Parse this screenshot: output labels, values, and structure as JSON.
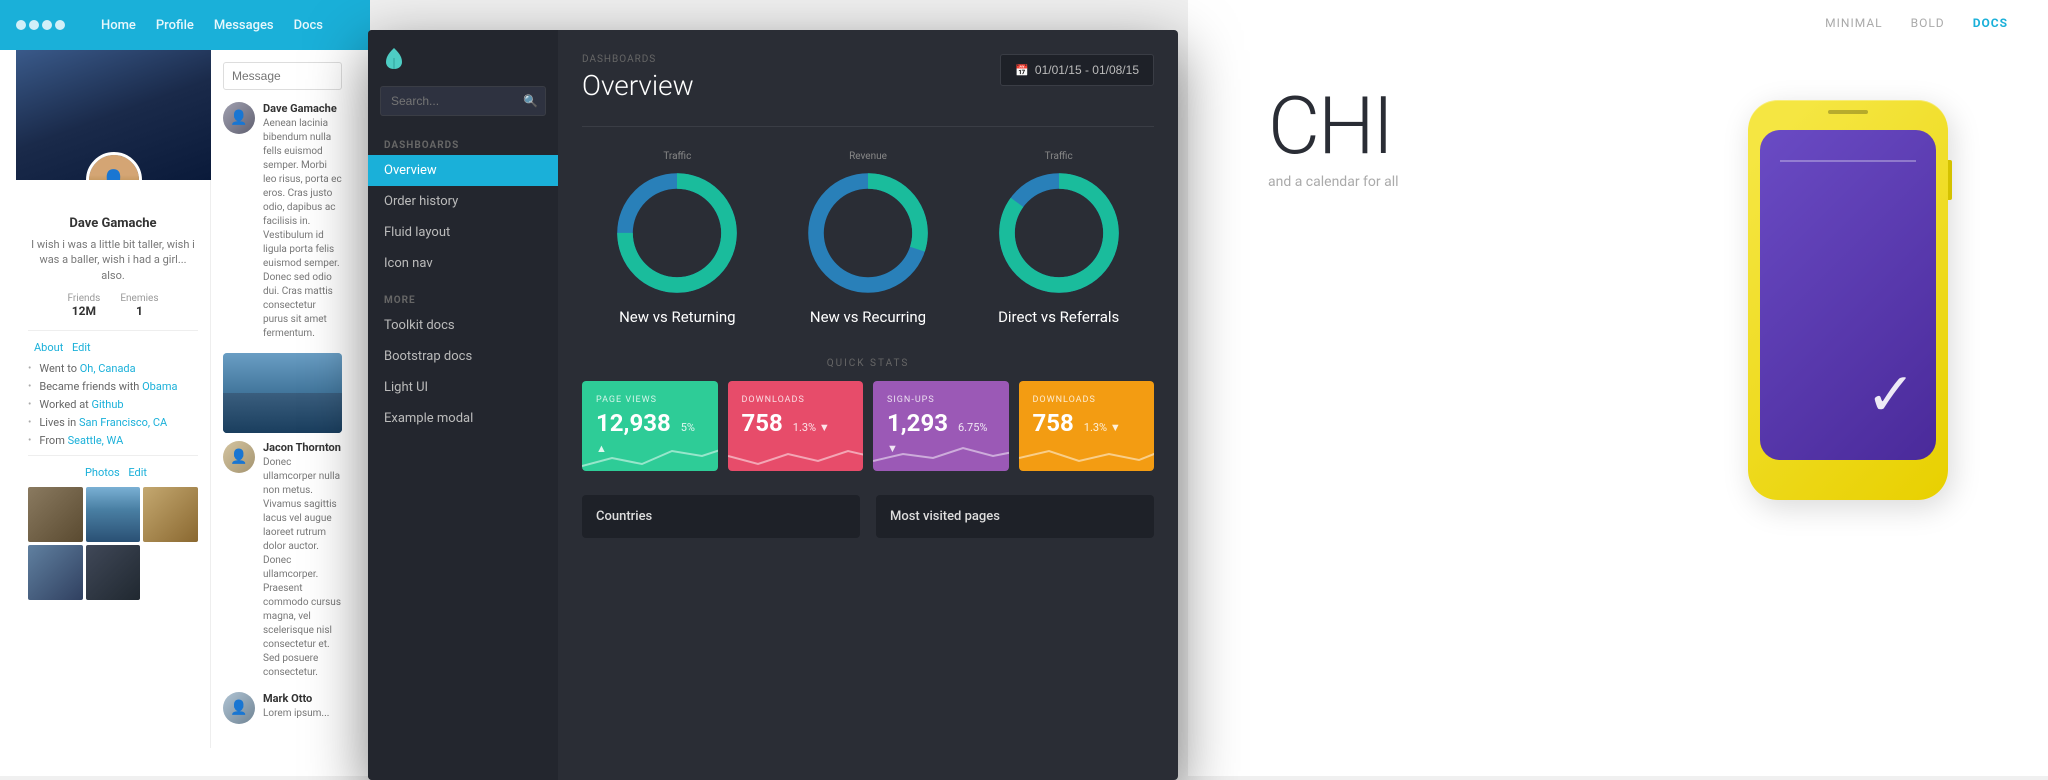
{
  "left_panel": {
    "nav": {
      "logo_dots": 4,
      "links": [
        "Home",
        "Profile",
        "Messages",
        "Docs"
      ],
      "active": "Profile"
    },
    "profile": {
      "name": "Dave Gamache",
      "bio": "I wish i was a little bit taller, wish i was a baller, wish i had a girl... also.",
      "stats": [
        {
          "label": "Friends",
          "value": "12M"
        },
        {
          "label": "Enemies",
          "value": "1"
        }
      ],
      "about_title": "About",
      "about_edit": "Edit",
      "about_items": [
        {
          "icon": "📍",
          "text": "Went to ",
          "link": "Oh, Canada"
        },
        {
          "icon": "👥",
          "text": "Became friends with ",
          "link": "Obama"
        },
        {
          "icon": "💼",
          "text": "Worked at ",
          "link": "Github"
        },
        {
          "icon": "🏠",
          "text": "Lives in ",
          "link": "San Francisco, CA"
        },
        {
          "icon": "📌",
          "text": "From ",
          "link": "Seattle, WA"
        }
      ],
      "photos_title": "Photos",
      "photos_edit": "Edit"
    },
    "messages": {
      "placeholder": "Message",
      "contacts": [
        {
          "name": "Dave Gamache",
          "text": "Aenean lacinia bibendum nulla fells euismod semper. Morbi leo risus, porta ec eros. Cras justo odio, dapibus ac facilisis in. Vestibulum id ligula porta felis euismod semper. Donec sed odio dui. Cras mattis consectetur purus sit amet fermentum."
        },
        {
          "name": "Jacon Thornton",
          "text": "Donec ullamcorper nulla non metus. Vivamus sagittis lacus vel augue laoreet rutrum dolor auctor. Donec ullamcorper. Praesent commodo cursus magna, vel scelerisque nisl consectetur et. Sed posuere consectetur."
        },
        {
          "name": "Mark Otto",
          "text": "Lorem ipsum..."
        }
      ]
    }
  },
  "dashboard": {
    "breadcrumb": "DASHBOARDS",
    "title": "Overview",
    "date_range": "01/01/15 - 01/08/15",
    "search_placeholder": "Search...",
    "nav_sections": [
      {
        "heading": "DASHBOARDS",
        "items": [
          {
            "label": "Overview",
            "active": true
          },
          {
            "label": "Order history",
            "active": false
          },
          {
            "label": "Fluid layout",
            "active": false
          },
          {
            "label": "Icon nav",
            "active": false
          }
        ]
      },
      {
        "heading": "MORE",
        "items": [
          {
            "label": "Toolkit docs",
            "active": false
          },
          {
            "label": "Bootstrap docs",
            "active": false
          },
          {
            "label": "Light UI",
            "active": false
          },
          {
            "label": "Example modal",
            "active": false
          }
        ]
      }
    ],
    "charts": [
      {
        "category": "Traffic",
        "title": "New vs Returning",
        "teal_pct": 75,
        "blue_pct": 25
      },
      {
        "category": "Revenue",
        "title": "New vs Recurring",
        "teal_pct": 30,
        "blue_pct": 70
      },
      {
        "category": "Traffic",
        "title": "Direct vs Referrals",
        "teal_pct": 85,
        "blue_pct": 15
      }
    ],
    "quick_stats_label": "QUICK STATS",
    "stat_cards": [
      {
        "label": "PAGE VIEWS",
        "value": "12,938",
        "change": "5% ▲",
        "color": "green"
      },
      {
        "label": "DOWNLOADS",
        "value": "758",
        "change": "1.3% ▼",
        "color": "red"
      },
      {
        "label": "SIGN-UPS",
        "value": "1,293",
        "change": "6.75% ▼",
        "color": "purple"
      },
      {
        "label": "DOWNLOADS",
        "value": "758",
        "change": "1.3% ▼",
        "color": "yellow"
      }
    ],
    "bottom_sections": [
      {
        "title": "Countries"
      },
      {
        "title": "Most visited pages"
      }
    ]
  },
  "right_panel": {
    "nav_links": [
      "MINIMAL",
      "BOLD",
      "DOCS"
    ],
    "active_nav": "DOCS",
    "hero_title": "CHI",
    "hero_subtitle": "and a calendar for all",
    "phone": {
      "screen_color": "#6a4bc4"
    }
  },
  "search_dash_label": "Search -",
  "more_label": "More",
  "countries_label": "Countries",
  "most_visited_label": "Most visited pages"
}
